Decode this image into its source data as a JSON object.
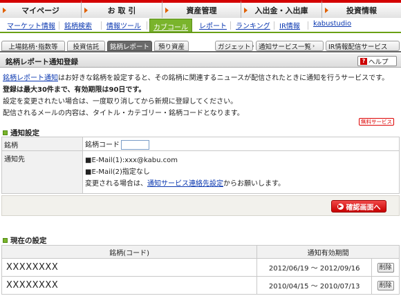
{
  "topnav": [
    {
      "label": "マイページ"
    },
    {
      "label": "お 取 引"
    },
    {
      "label": "資産管理"
    },
    {
      "label": "入出金・入出庫"
    },
    {
      "label": "投資情報"
    }
  ],
  "subnav": [
    {
      "label": "マーケット情報"
    },
    {
      "label": "銘柄検索"
    },
    {
      "label": "情報ツール"
    },
    {
      "label": "カブコール"
    },
    {
      "label": "レポート"
    },
    {
      "label": "ランキング"
    },
    {
      "label": "IR情報"
    },
    {
      "label": "kabustudio"
    }
  ],
  "tabs": [
    {
      "label": "上場銘柄･指数等"
    },
    {
      "label": "投資信託"
    },
    {
      "label": "銘柄レポート"
    },
    {
      "label": "預り資産"
    }
  ],
  "right_tabs": [
    {
      "label": "ガジェット"
    },
    {
      "label": "通知サービス一覧"
    },
    {
      "label": "IR情報配信サービス"
    }
  ],
  "title": "銘柄レポート通知登録",
  "help_label": "ヘルプ",
  "intro": {
    "link": "銘柄レポート通知",
    "line1_rest": "はお好きな銘柄を設定すると、その銘柄に関連するニュースが配信されたときに通知を行うサービスです。",
    "line2": "登録は最大30件まで、有効期限は90日です。",
    "line3": "設定を変更されたい場合は、一度取り消してから新規に登録してください。",
    "line4": "配信されるメールの内容は、タイトル・カテゴリー・銘柄コードとなります。"
  },
  "free_badge": "無料サービス",
  "notify_section": {
    "title": "通知設定",
    "brand_label": "銘柄",
    "brand_code_label": "銘柄コード",
    "brand_code_value": "",
    "dest_label": "通知先",
    "email1": "■E-Mail(1):xxx@kabu.com",
    "email2": "■E-Mail(2)指定なし",
    "change_prefix": "変更される場合は、",
    "change_link": "通知サービス連絡先設定",
    "change_suffix": "からお願いします。"
  },
  "confirm_label": "確認画面へ",
  "current_section": {
    "title": "現在の設定",
    "col_brand": "銘柄(コード)",
    "col_period": "通知有効期間",
    "rows": [
      {
        "brand": "XXXXXXXX",
        "period": "2012/06/19 ～ 2012/09/16",
        "action": "削除"
      },
      {
        "brand": "XXXXXXXX",
        "period": "2010/04/15 ～ 2010/07/13",
        "action": "削除"
      }
    ]
  },
  "colors": {
    "brand_red": "#d40000",
    "accent_green": "#7ab42c",
    "link_blue": "#0a37b0"
  }
}
